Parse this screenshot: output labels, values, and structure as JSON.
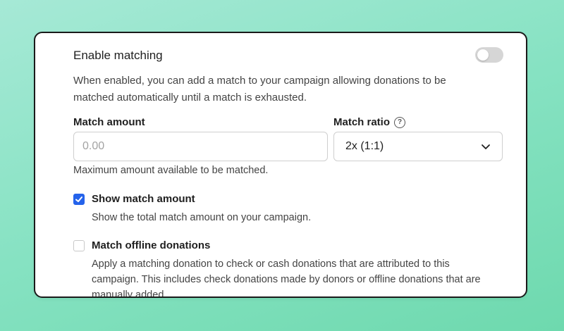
{
  "matching": {
    "title": "Enable matching",
    "toggle_on": false,
    "description": "When enabled, you can add a match to your campaign allowing donations to be matched automatically until a match is exhausted."
  },
  "match_amount": {
    "label": "Match amount",
    "placeholder": "0.00",
    "value": "",
    "hint": "Maximum amount available to be matched."
  },
  "match_ratio": {
    "label": "Match ratio",
    "help_icon": "question-circle-icon",
    "selected": "2x (1:1)"
  },
  "options": [
    {
      "label": "Show match amount",
      "checked": true,
      "description": "Show the total match amount on your campaign."
    },
    {
      "label": "Match offline donations",
      "checked": false,
      "description": "Apply a matching donation to check or cash donations that are attributed to this campaign. This includes check donations made by donors or offline donations that are manually added."
    }
  ],
  "colors": {
    "accent": "#2563eb",
    "background": "#86e2c2"
  }
}
